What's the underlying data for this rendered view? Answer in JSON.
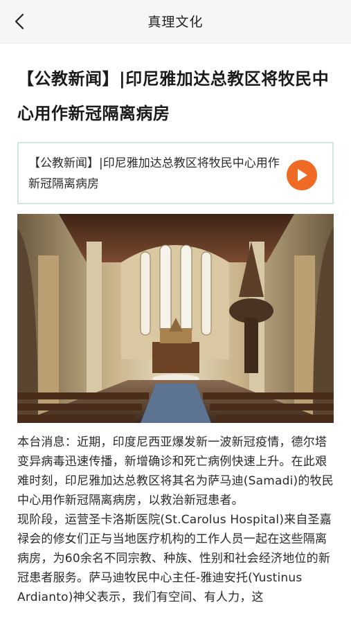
{
  "header": {
    "back_icon": "chevron-left-icon",
    "title": "真理文化"
  },
  "article": {
    "title": "【公教新闻】|印尼雅加达总教区将牧民中心用作新冠隔离病房",
    "audio": {
      "text": "【公教新闻】|印尼雅加达总教区将牧民中心用作新冠隔离病房",
      "play_icon": "play-icon",
      "accent_color": "#ef6a24"
    },
    "image_icon": "cathedral-interior-photo",
    "paragraphs": [
      "本台消息：近期，印度尼西亚爆发新一波新冠疫情，德尔塔变异病毒迅速传播，新增确诊和死亡病例快速上升。在此艰难时刻，印尼雅加达总教区将其名为萨马迪(Samadi)的牧民中心用作新冠隔离病房，以救治新冠患者。",
      "现阶段，运营圣卡洛斯医院(St.Carolus Hospital)来自圣嘉禄会的修女们正与当地医疗机构的工作人员一起在这些隔离病房，为60余名不同宗教、种族、性别和社会经济地位的新冠患者服务。萨马迪牧民中心主任-雅迪安托(Yustinus Ardianto)神父表示，我们有空间、有人力，这"
    ]
  }
}
